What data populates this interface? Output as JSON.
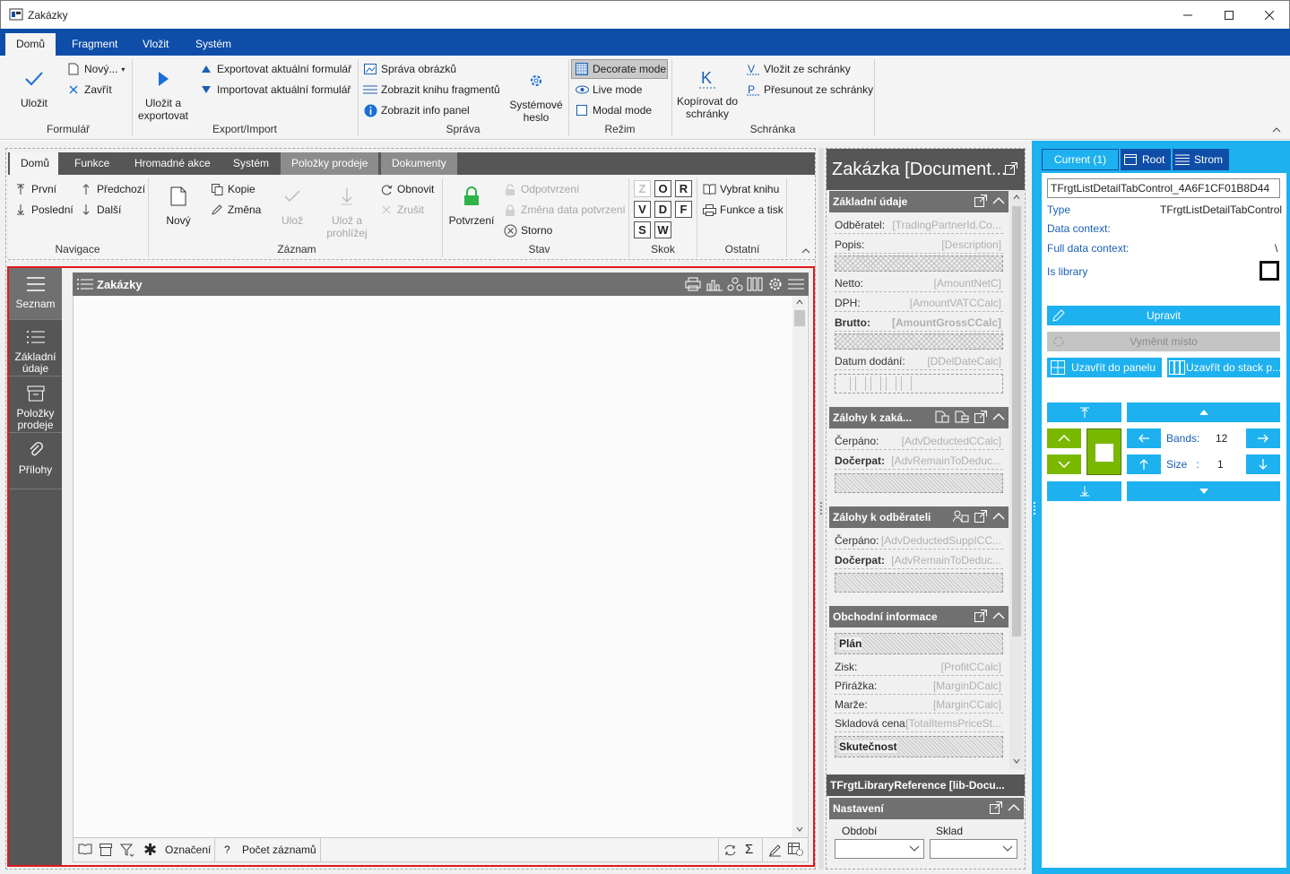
{
  "window": {
    "title": "Zakázky"
  },
  "ribbon": {
    "tabs": [
      "Domů",
      "Fragment",
      "Vložit",
      "Systém"
    ],
    "formular": {
      "ulozit": "Uložit",
      "novy": "Nový...",
      "zavrit": "Zavřít",
      "group": "Formulář"
    },
    "export": {
      "ulozit_export": "Uložit a exportovat",
      "exportovat": "Exportovat aktuální formulář",
      "importovat": "Importovat aktuální formulář",
      "group": "Export/Import"
    },
    "sprava": {
      "obrazky": "Správa obrázků",
      "kniha": "Zobrazit knihu fragmentů",
      "info": "Zobrazit info panel",
      "heslo": "Systémové heslo",
      "group": "Správa"
    },
    "rezim": {
      "decorate": "Decorate mode",
      "live": "Live mode",
      "modal": "Modal mode",
      "group": "Režim"
    },
    "schranka": {
      "kopirovat": "Kopírovat do schránky",
      "vlozit": "Vložit ze schránky",
      "presunout": "Přesunout ze schránky",
      "group": "Schránka"
    }
  },
  "inner": {
    "tabs": [
      "Domů",
      "Funkce",
      "Hromadné akce",
      "Systém",
      "Položky prodeje",
      "Dokumenty"
    ],
    "navigace": {
      "prvni": "První",
      "posledni": "Poslední",
      "predchozi": "Předchozí",
      "dalsi": "Další",
      "group": "Navigace"
    },
    "zaznam": {
      "novy": "Nový",
      "kopie": "Kopie",
      "zmena": "Změna",
      "uloz": "Ulož",
      "uloz_prohlizej": "Ulož a prohlížej",
      "obnovit": "Obnovit",
      "zrusit": "Zrušit",
      "group": "Záznam"
    },
    "stav": {
      "potvrzeni": "Potvrzení",
      "odpotvrzeni": "Odpotvrzení",
      "zmena_data": "Změna data potvrzení",
      "storno": "Storno",
      "group": "Stav"
    },
    "skok": {
      "keys": [
        "Z",
        "O",
        "R",
        "V",
        "D",
        "F",
        "S",
        "W"
      ],
      "group": "Skok"
    },
    "ostatni": {
      "vybrat": "Vybrat knihu",
      "funkce": "Funkce a tisk",
      "group": "Ostatní"
    }
  },
  "sidenav": {
    "items": [
      "Seznam",
      "Základní údaje",
      "Položky prodeje",
      "Přílohy"
    ]
  },
  "grid": {
    "title": "Zakázky",
    "footer": {
      "oznaceni": "Označení",
      "pocet": "Počet záznamů"
    }
  },
  "detail": {
    "title": "Zakázka [Document...",
    "zakladni": {
      "title": "Základní údaje",
      "rows": [
        {
          "k": "Odběratel:",
          "v": "[TradingPartnerId.Co..."
        },
        {
          "k": "Popis:",
          "v": "[Description]"
        },
        {
          "k": "Netto:",
          "v": "[AmountNetC]"
        },
        {
          "k": "DPH:",
          "v": "[AmountVATCCalc]"
        },
        {
          "k": "Brutto:",
          "v": "[AmountGrossCCalc]"
        },
        {
          "k": "Datum dodání:",
          "v": "[DDelDateCalc]"
        }
      ]
    },
    "zalohy_zak": {
      "title": "Zálohy k zaká...",
      "rows": [
        {
          "k": "Čerpáno:",
          "v": "[AdvDeductedCCalc]"
        },
        {
          "k": "Dočerpat:",
          "v": "[AdvRemainToDeduc..."
        }
      ]
    },
    "zalohy_odb": {
      "title": "Zálohy k odběrateli",
      "rows": [
        {
          "k": "Čerpáno:",
          "v": "[AdvDeductedSuppICC..."
        },
        {
          "k": "Dočerpat:",
          "v": "[AdvRemainToDeduc..."
        }
      ]
    },
    "obchodni": {
      "title": "Obchodní informace",
      "plan": "Plán",
      "skutecnost": "Skutečnost",
      "rows": [
        {
          "k": "Zisk:",
          "v": "[ProfitCCalc]"
        },
        {
          "k": "Přirážka:",
          "v": "[MarginDCalc]"
        },
        {
          "k": "Marže:",
          "v": "[MarginCCalc]"
        },
        {
          "k": "Skladová cena:",
          "v": "[TotalItemsPriceSt..."
        }
      ]
    },
    "libref": "TFrgtLibraryReference [lib-Docu...",
    "nastaveni": {
      "title": "Nastavení",
      "obdobi": "Období",
      "sklad": "Sklad"
    }
  },
  "right": {
    "tabs": {
      "current": "Current (1)",
      "root": "Root",
      "strom": "Strom"
    },
    "name_value": "TFrgtListDetailTabControl_4A6F1CF01B8D44",
    "props": {
      "type_label": "Type",
      "type_value": "TFrgtListDetailTabControl",
      "data_context": "Data context:",
      "full_context": "Full data context:",
      "full_value": "\\",
      "is_library": "Is library"
    },
    "buttons": {
      "upravit": "Upravit",
      "vymenit": "Vyměnit místo",
      "uzavrit_panel": "Uzavřít do panelu",
      "uzavrit_stack": "Uzavřít do stack p..."
    },
    "bands_label": "Bands:",
    "bands_value": "12",
    "size_label": "Size   :",
    "size_value": "1"
  },
  "colors": {
    "ribbon_blue": "#0f4ea8",
    "accent_cyan": "#1db1f0",
    "highlight_red": "#e0191d",
    "green": "#7ab800"
  }
}
